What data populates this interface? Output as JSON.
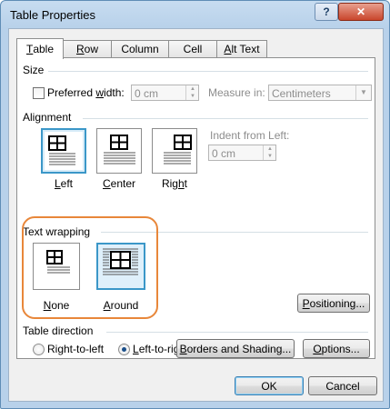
{
  "window": {
    "title": "Table Properties",
    "help_label": "?",
    "close_label": "✕"
  },
  "tabs": [
    {
      "label": "Table",
      "ul": "T",
      "rest": "able",
      "active": true
    },
    {
      "label": "Row",
      "ul": "R",
      "rest": "ow",
      "active": false
    },
    {
      "label": "Column",
      "ul": "Col",
      "rest": "umn",
      "active": false
    },
    {
      "label": "Cell",
      "ul": "E",
      "rest": "",
      "active": false
    },
    {
      "label": "Alt Text",
      "ul": "A",
      "rest": "lt Text",
      "active": false
    }
  ],
  "size": {
    "section_label": "Size",
    "preferred_width_pre": "Preferred ",
    "preferred_width_ul": "w",
    "preferred_width_post": "idth:",
    "preferred_width_checked": false,
    "width_value": "0 cm",
    "measure_in_label": "Measure in:",
    "measure_in_value": "Centimeters"
  },
  "alignment": {
    "section_label": "Alignment",
    "left_ul": "L",
    "left_rest": "eft",
    "center_ul": "C",
    "center_rest": "enter",
    "right_pre": "Rig",
    "right_ul": "h",
    "right_post": "t",
    "selected": "Left",
    "indent_label": "Indent from Left:",
    "indent_value": "0 cm"
  },
  "text_wrapping": {
    "section_label": "Text wrapping",
    "none_ul": "N",
    "none_rest": "one",
    "around_ul": "A",
    "around_rest": "round",
    "selected": "Around",
    "positioning_pre": "",
    "positioning_ul": "P",
    "positioning_post": "ositioning..."
  },
  "direction": {
    "section_label": "Table direction",
    "rtl_label": "Right-to-left",
    "ltr_pre": "",
    "ltr_ul": "L",
    "ltr_post": "eft-to-right",
    "selected": "Left-to-right"
  },
  "actions": {
    "borders_pre": "",
    "borders_ul": "B",
    "borders_post": "orders and Shading...",
    "options_ul": "O",
    "options_post": "ptions...",
    "ok": "OK",
    "cancel": "Cancel"
  },
  "colors": {
    "highlight": "#e8873a",
    "selection": "#3b97c8"
  }
}
